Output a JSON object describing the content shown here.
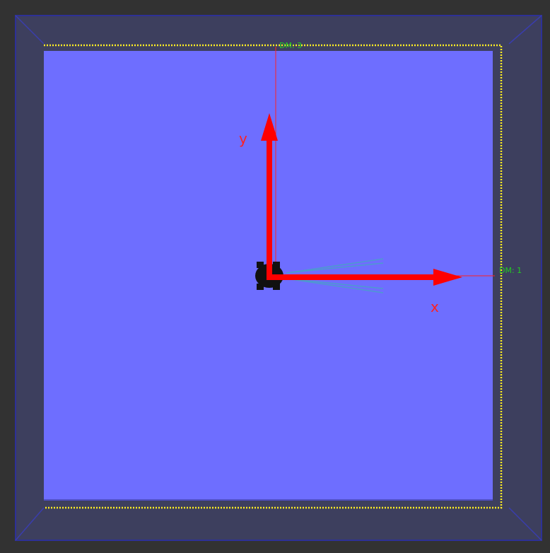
{
  "scene": {
    "background_color": "#323232",
    "arena_wall_color": "#3d3f5e",
    "floor_color": "#6e6eff",
    "lidar_scan_color": "#ffee22",
    "axis_color": "#ff0000",
    "range_label_color": "#22cc22",
    "robot_color": "#111111",
    "sensor_beam_color": "#4a9fc9"
  },
  "axes": {
    "x_label": "x",
    "y_label": "y"
  },
  "range_markers": {
    "top_label": "DM: 3",
    "right_label": "DM: 1"
  },
  "robot": {
    "name": "robot-icon",
    "heading": "east"
  }
}
